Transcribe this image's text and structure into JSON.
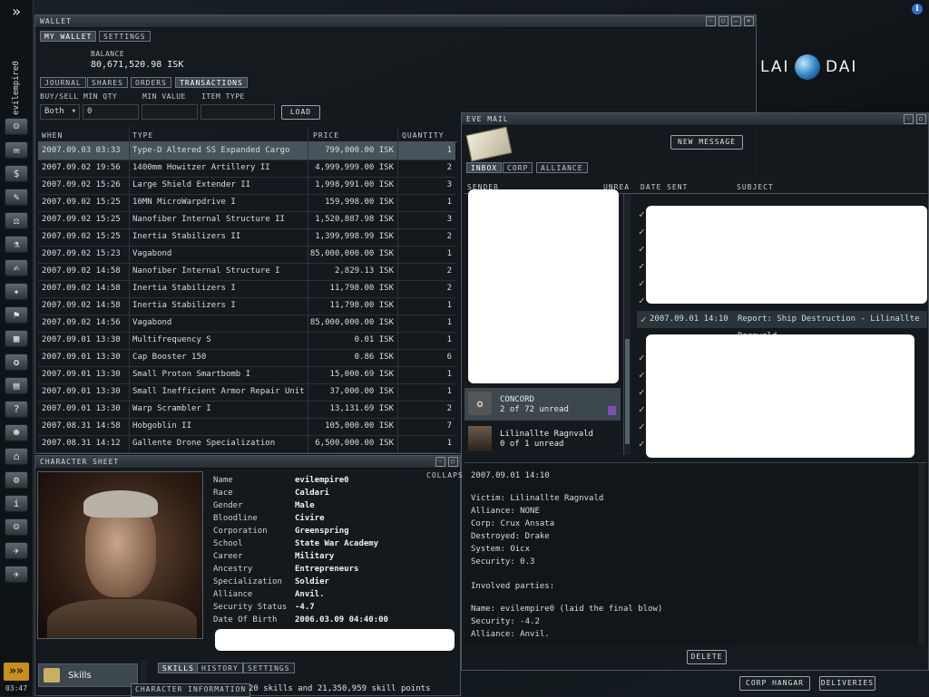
{
  "sidebar": {
    "pilot_name": "evilempire0",
    "clock": "03:47",
    "expand_glyph": "»",
    "icons": [
      "character-icon",
      "mail-icon",
      "wallet-icon",
      "notepad-icon",
      "market-icon",
      "science-icon",
      "contracts-icon",
      "map-icon",
      "corporation-icon",
      "assets-icon",
      "skills-icon",
      "calculator-icon",
      "help-icon",
      "people-icon",
      "station-icon",
      "fitting-icon",
      "info-icon",
      "portrait-icon",
      "drone-icon",
      "ship-icon"
    ]
  },
  "info_icon": "i",
  "brand": {
    "left": "LAI",
    "right": "DAI"
  },
  "wallet": {
    "title": "WALLET",
    "tabs": [
      "MY WALLET",
      "SETTINGS"
    ],
    "balance_label": "BALANCE",
    "balance_value": "80,671,520.98 ISK",
    "subtabs": [
      "JOURNAL",
      "SHARES",
      "ORDERS",
      "TRANSACTIONS"
    ],
    "filter_labels": [
      "BUY/SELL",
      "MIN QTY",
      "MIN VALUE",
      "ITEM TYPE"
    ],
    "buy_sell_value": "Both",
    "min_qty_value": "0",
    "load_label": "LOAD",
    "columns": [
      "WHEN",
      "TYPE",
      "PRICE",
      "QUANTITY"
    ],
    "rows": [
      {
        "when": "2007.09.03 03:33",
        "type": "Type-D Altered SS Expanded Cargo",
        "price": "799,000.00 ISK",
        "qty": "1"
      },
      {
        "when": "2007.09.02 19:56",
        "type": "1400mm Howitzer Artillery II",
        "price": "4,999,999.00 ISK",
        "qty": "2"
      },
      {
        "when": "2007.09.02 15:26",
        "type": "Large Shield Extender II",
        "price": "1,998,991.00 ISK",
        "qty": "3"
      },
      {
        "when": "2007.09.02 15:25",
        "type": "10MN MicroWarpdrive I",
        "price": "159,998.00 ISK",
        "qty": "1"
      },
      {
        "when": "2007.09.02 15:25",
        "type": "Nanofiber Internal Structure II",
        "price": "1,520,887.98 ISK",
        "qty": "3"
      },
      {
        "when": "2007.09.02 15:25",
        "type": "Inertia Stabilizers II",
        "price": "1,399,998.99 ISK",
        "qty": "2"
      },
      {
        "when": "2007.09.02 15:23",
        "type": "Vagabond",
        "price": "85,000,000.00 ISK",
        "qty": "1"
      },
      {
        "when": "2007.09.02 14:58",
        "type": "Nanofiber Internal Structure I",
        "price": "2,829.13 ISK",
        "qty": "2"
      },
      {
        "when": "2007.09.02 14:58",
        "type": "Inertia Stabilizers I",
        "price": "11,798.00 ISK",
        "qty": "2"
      },
      {
        "when": "2007.09.02 14:58",
        "type": "Inertia Stabilizers I",
        "price": "11,798.00 ISK",
        "qty": "1"
      },
      {
        "when": "2007.09.02 14:56",
        "type": "Vagabond",
        "price": "85,000,000.00 ISK",
        "qty": "1"
      },
      {
        "when": "2007.09.01 13:30",
        "type": "Multifrequency S",
        "price": "0.01 ISK",
        "qty": "1"
      },
      {
        "when": "2007.09.01 13:30",
        "type": "Cap Booster 150",
        "price": "0.86 ISK",
        "qty": "6"
      },
      {
        "when": "2007.09.01 13:30",
        "type": "Small Proton Smartbomb I",
        "price": "15,000.69 ISK",
        "qty": "1"
      },
      {
        "when": "2007.09.01 13:30",
        "type": "Small Inefficient Armor Repair Unit",
        "price": "37,000.00 ISK",
        "qty": "1"
      },
      {
        "when": "2007.09.01 13:30",
        "type": "Warp Scrambler I",
        "price": "13,131.69 ISK",
        "qty": "2"
      },
      {
        "when": "2007.08.31 14:58",
        "type": "Hobgoblin II",
        "price": "105,000.00 ISK",
        "qty": "7"
      },
      {
        "when": "2007.08.31 14:12",
        "type": "Gallente Drone Specialization",
        "price": "6,500,000.00 ISK",
        "qty": "1"
      }
    ]
  },
  "character_sheet": {
    "title": "CHARACTER SHEET",
    "collapse_label": "COLLAPS",
    "fields": [
      {
        "label": "Name",
        "value": "evilempire0"
      },
      {
        "label": "Race",
        "value": "Caldari"
      },
      {
        "label": "Gender",
        "value": "Male"
      },
      {
        "label": "Bloodline",
        "value": "Civire"
      },
      {
        "label": "Corporation",
        "value": "Greenspring"
      },
      {
        "label": "School",
        "value": "State War Academy"
      },
      {
        "label": "Career",
        "value": "Military"
      },
      {
        "label": "Ancestry",
        "value": "Entrepreneurs"
      },
      {
        "label": "Specialization",
        "value": "Soldier"
      },
      {
        "label": "Alliance",
        "value": "Anvil."
      },
      {
        "label": "Security Status",
        "value": "-4.7"
      },
      {
        "label": "Date Of Birth",
        "value": "2006.03.09 04:40:00"
      }
    ],
    "nav_item": "Skills",
    "nav_item2": "CHARACTER INFORMATION",
    "tabs": [
      "SKILLS",
      "HISTORY",
      "SETTINGS"
    ],
    "skills_summary": "20 skills and 21,350,959 skill points"
  },
  "eve_mail": {
    "title": "EVE MAIL",
    "new_message_label": "NEW MESSAGE",
    "tabs": [
      "INBOX",
      "CORP",
      "ALLIANCE"
    ],
    "columns": [
      "SENDER",
      "UNREA",
      "DATE SENT",
      "SUBJECT"
    ],
    "senders": [
      {
        "name": "CONCORD",
        "unread": "2 of 72 unread"
      },
      {
        "name": "Lilinallte Ragnvald",
        "unread": "0 of 1 unread"
      }
    ],
    "selected_row": {
      "date": "2007.09.01 14:10",
      "subject": "Report: Ship Destruction - Lilinallte Ragnvald"
    },
    "message": {
      "date": "2007.09.01 14:10",
      "lines": [
        "Victim: Lilinallte Ragnvald",
        "Alliance: NONE",
        "Corp: Crux Ansata",
        "Destroyed: Drake",
        "System: Oicx",
        "Security: 0.3"
      ],
      "involved_heading": "Involved parties:",
      "involved": [
        "Name: evilempire0 (laid the final blow)",
        "Security: -4.2",
        "Alliance: Anvil."
      ]
    },
    "delete_label": "DELETE"
  },
  "bottom_buttons": [
    "CORP HANGAR",
    "DELIVERIES"
  ],
  "colors": {
    "accent_gold": "#cbb870",
    "selected_row": "#47545b",
    "panel_bg": "#141a1e"
  }
}
